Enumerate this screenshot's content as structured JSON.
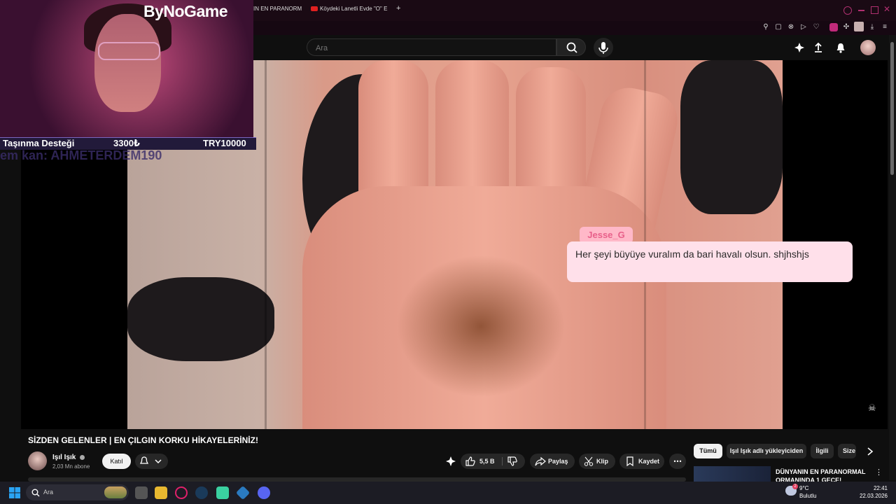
{
  "browser": {
    "tabs": [
      {
        "label": "IN EN PARANORM"
      },
      {
        "label": "Köydeki Lanetli Evde \"O\" E"
      }
    ],
    "new_tab_symbol": "+"
  },
  "youtube": {
    "search": {
      "placeholder": "Ara"
    },
    "video": {
      "title": "SİZDEN GELENLER | EN ÇILGIN KORKU HİKAYELERİNİZ!",
      "channel_name": "Işıl Işık",
      "subscribers": "2,03 Mn abone",
      "join_label": "Katıl",
      "like_count": "5,5 B",
      "share_label": "Paylaş",
      "clip_label": "Klip",
      "save_label": "Kaydet"
    },
    "chips": [
      "Tümü",
      "Işıl Işık adlı yükleyiciden",
      "İlgili",
      "Size"
    ],
    "related": {
      "title": "DÜNYANIN EN PARANORMAL ORMANINDA 1 GECE!"
    }
  },
  "stream_overlay": {
    "brand": "ByNoGame",
    "support_label": "Taşınma Desteği",
    "support_amount": "3300₺",
    "support_goal": "TRY10000",
    "donor_line": "em kan: AHMETERDEM190",
    "chat": {
      "username": "Jesse_G",
      "message": "Her şeyi büyüye vuralım da bari havalı olsun. shjhshjs"
    }
  },
  "taskbar": {
    "search_placeholder": "Ara",
    "weather_temp": "9°C",
    "weather_desc": "Bulutlu",
    "time": "22:41",
    "date": "22.03.2026",
    "notification_count": "2"
  },
  "colors": {
    "accent_pink": "#e8608a",
    "youtube_bg": "#0f0f0f",
    "chip_active": "#f1f1f1"
  }
}
